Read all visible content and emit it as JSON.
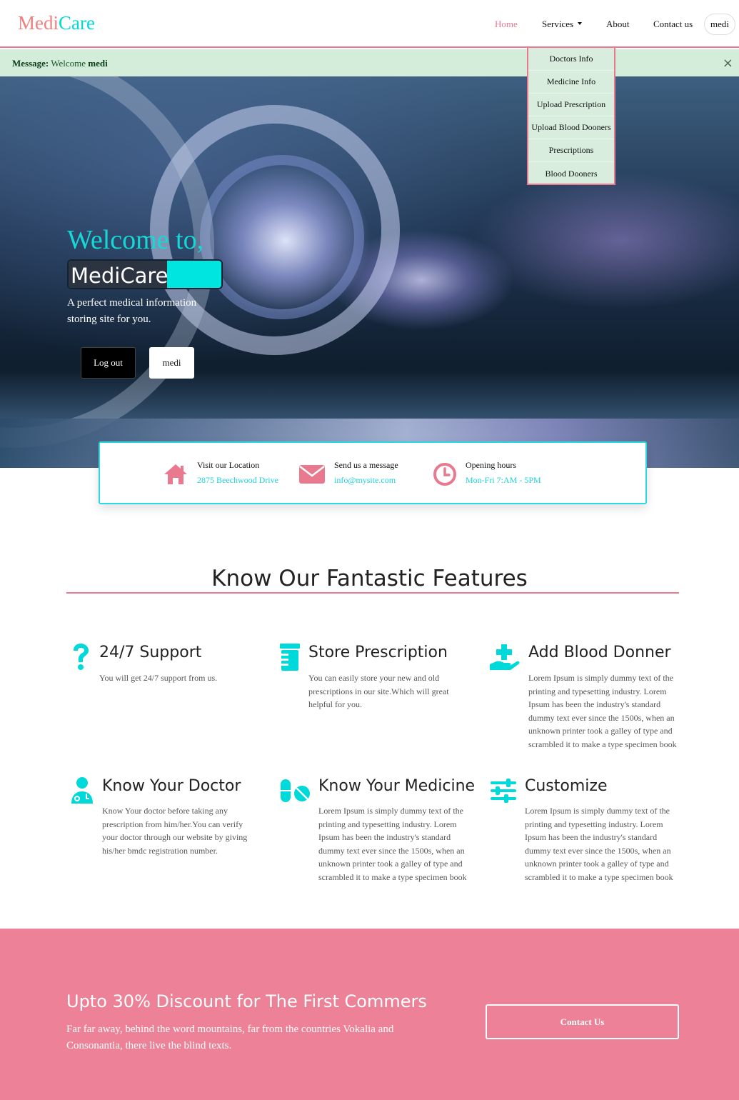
{
  "navbar": {
    "brand_part1": "Medi",
    "brand_part2": "Care",
    "links": [
      "Home",
      "Services",
      "About",
      "Contact us"
    ],
    "user_button": "medi"
  },
  "alert": {
    "label": "Message:",
    "text": "Welcome",
    "user": "medi",
    "close": "×"
  },
  "services_dropdown": [
    "Doctors Info",
    "Medicine Info",
    "Upload Prescription",
    "Upload Blood Dooners",
    "Prescriptions",
    "Blood Dooners"
  ],
  "hero": {
    "title": "Welcome to,",
    "brand": "MediCare",
    "description": "A perfect medical information storing site for you.",
    "logout_button": "Log out",
    "user_button": "medi"
  },
  "info": [
    {
      "icon": "home-icon",
      "title": "Visit our Location",
      "sub": "2875 Beechwood Drive"
    },
    {
      "icon": "envelope-icon",
      "title": "Send us a message",
      "sub": "info@mysite.com"
    },
    {
      "icon": "clock-icon",
      "title": "Opening hours",
      "sub": "Mon-Fri 7:AM - 5PM"
    }
  ],
  "features": {
    "heading": "Know Our Fantastic Features",
    "items": [
      {
        "icon": "question-icon",
        "title": "24/7 Support",
        "text": "You will get 24/7 support from us."
      },
      {
        "icon": "prescription-icon",
        "title": "Store Prescription",
        "text": "You can easily store your new and old prescriptions in our site.Which will great helpful for you."
      },
      {
        "icon": "hand-holding-medical-icon",
        "title": "Add Blood Donner",
        "text": "Lorem Ipsum is simply dummy text of the printing and typesetting industry. Lorem Ipsum has been the industry's standard dummy text ever since the 1500s, when an unknown printer took a galley of type and scrambled it to make a type specimen book"
      },
      {
        "icon": "user-doctor-icon",
        "title": "Know Your Doctor",
        "text": "Know Your doctor before taking any prescription from him/her.You can verify your doctor through our website by giving his/her bmdc registration number."
      },
      {
        "icon": "pills-icon",
        "title": "Know Your Medicine",
        "text": "Lorem Ipsum is simply dummy text of the printing and typesetting industry. Lorem Ipsum has been the industry's standard dummy text ever since the 1500s, when an unknown printer took a galley of type and scrambled it to make a type specimen book"
      },
      {
        "icon": "sliders-icon",
        "title": "Customize",
        "text": "Lorem Ipsum is simply dummy text of the printing and typesetting industry. Lorem Ipsum has been the industry's standard dummy text ever since the 1500s, when an unknown printer took a galley of type and scrambled it to make a type specimen book"
      }
    ]
  },
  "cta": {
    "title": "Upto 30% Discount for The First Commers",
    "text": "Far far away, behind the word mountains, far from the countries Vokalia and Consonantia, there live the blind texts.",
    "button": "Contact Us"
  },
  "colors": {
    "accent_pink": "#e8798f",
    "accent_cyan": "#00d9d9",
    "cta_bg": "#ec8197",
    "alert_bg": "#d4edda"
  }
}
